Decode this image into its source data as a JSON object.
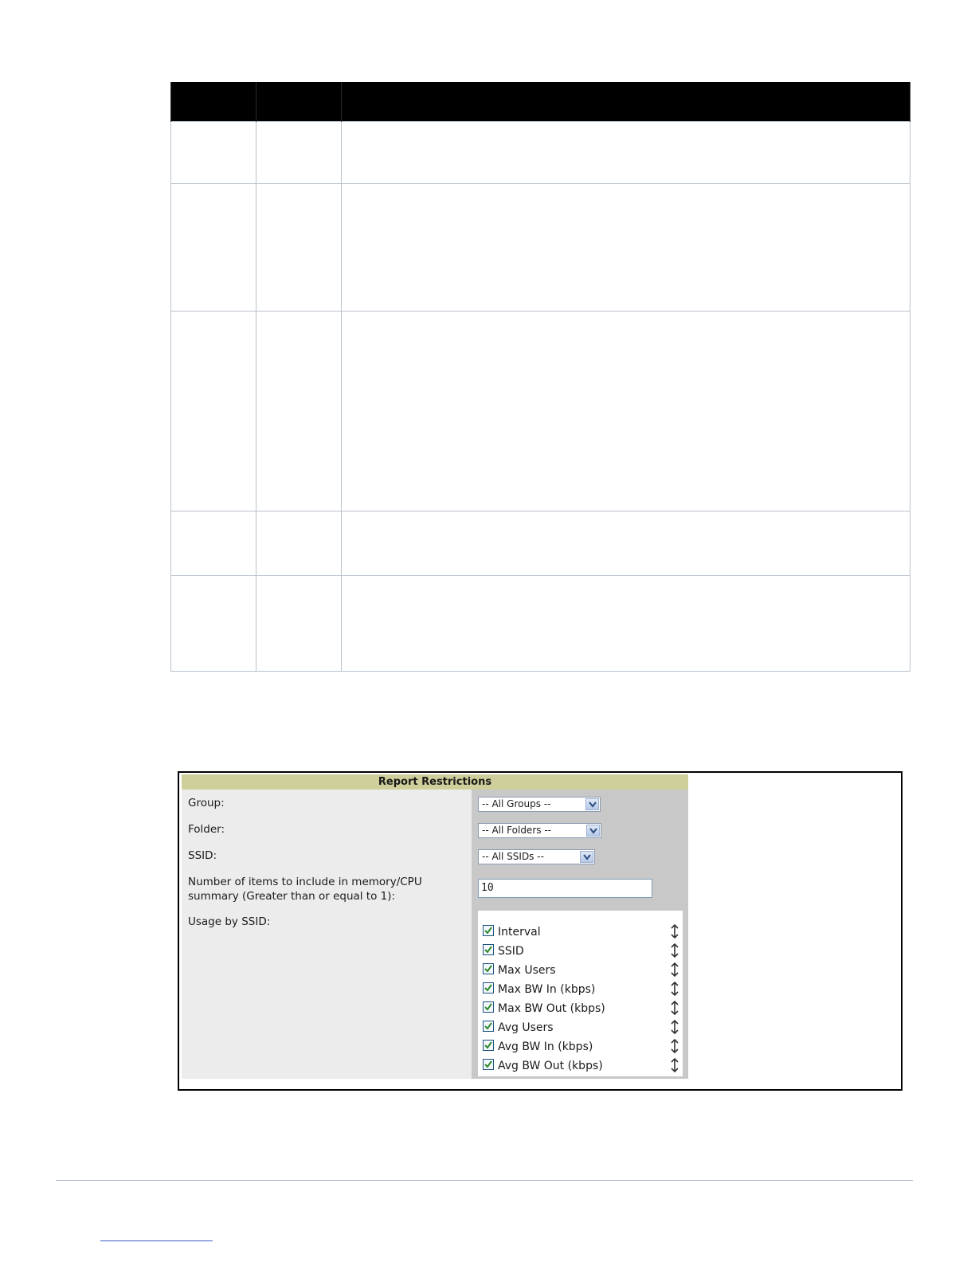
{
  "doc_table": {
    "columns": [
      "",
      "",
      ""
    ],
    "rows": [
      [
        "",
        "",
        ""
      ],
      [
        "",
        "",
        ""
      ],
      [
        "",
        "",
        ""
      ],
      [
        "",
        "",
        ""
      ],
      [
        "",
        "",
        ""
      ]
    ]
  },
  "report_restrictions": {
    "title": "Report Restrictions",
    "group": {
      "label": "Group:",
      "value": "-- All Groups --"
    },
    "folder": {
      "label": "Folder:",
      "value": "-- All Folders --"
    },
    "ssid": {
      "label": "SSID:",
      "value": "-- All SSIDs --"
    },
    "num_items": {
      "label_line1": "Number of items to include in memory/CPU",
      "label_line2": "summary (Greater than or equal to 1):",
      "value": "10"
    },
    "usage_by_ssid": {
      "label": "Usage by SSID:",
      "options": [
        {
          "label": "Interval",
          "checked": true
        },
        {
          "label": "SSID",
          "checked": true
        },
        {
          "label": "Max Users",
          "checked": true
        },
        {
          "label": "Max BW In (kbps)",
          "checked": true
        },
        {
          "label": "Max BW Out (kbps)",
          "checked": true
        },
        {
          "label": "Avg Users",
          "checked": true
        },
        {
          "label": "Avg BW In (kbps)",
          "checked": true
        },
        {
          "label": "Avg BW Out (kbps)",
          "checked": true
        }
      ]
    }
  },
  "colors": {
    "header_band": "#000000",
    "panel_title_bg": "#cfcf9c",
    "panel_bg": "#ececec",
    "checkbox_check": "#2a8a2a"
  }
}
